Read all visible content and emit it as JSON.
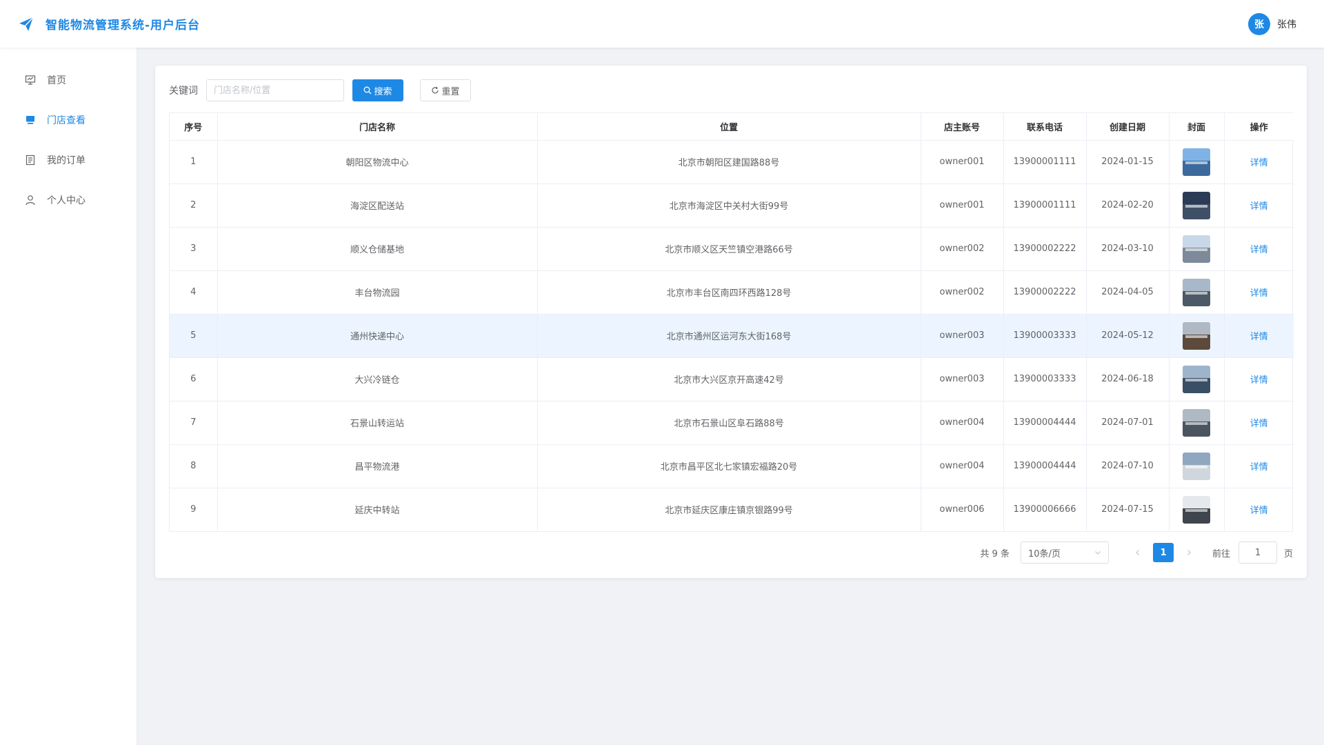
{
  "header": {
    "title": "智能物流管理系统-用户后台",
    "avatar_text": "张",
    "username": "张伟"
  },
  "sidebar": {
    "items": [
      {
        "label": "首页",
        "icon": "presentation-icon",
        "active": false
      },
      {
        "label": "门店查看",
        "icon": "monitor-icon",
        "active": true
      },
      {
        "label": "我的订单",
        "icon": "document-icon",
        "active": false
      },
      {
        "label": "个人中心",
        "icon": "user-icon",
        "active": false
      }
    ]
  },
  "search": {
    "label": "关键词",
    "placeholder": "门店名称/位置",
    "search_button": "搜索",
    "reset_button": "重置"
  },
  "table": {
    "columns": [
      "序号",
      "门店名称",
      "位置",
      "店主账号",
      "联系电话",
      "创建日期",
      "封面",
      "操作"
    ],
    "rows": [
      {
        "index": "1",
        "name": "朝阳区物流中心",
        "location": "北京市朝阳区建国路88号",
        "owner": "owner001",
        "phone": "13900001111",
        "date": "2024-01-15",
        "action": "详情"
      },
      {
        "index": "2",
        "name": "海淀区配送站",
        "location": "北京市海淀区中关村大街99号",
        "owner": "owner001",
        "phone": "13900001111",
        "date": "2024-02-20",
        "action": "详情"
      },
      {
        "index": "3",
        "name": "顺义仓储基地",
        "location": "北京市顺义区天竺镇空港路66号",
        "owner": "owner002",
        "phone": "13900002222",
        "date": "2024-03-10",
        "action": "详情"
      },
      {
        "index": "4",
        "name": "丰台物流园",
        "location": "北京市丰台区南四环西路128号",
        "owner": "owner002",
        "phone": "13900002222",
        "date": "2024-04-05",
        "action": "详情"
      },
      {
        "index": "5",
        "name": "通州快递中心",
        "location": "北京市通州区运河东大街168号",
        "owner": "owner003",
        "phone": "13900003333",
        "date": "2024-05-12",
        "action": "详情"
      },
      {
        "index": "6",
        "name": "大兴冷链仓",
        "location": "北京市大兴区京开高速42号",
        "owner": "owner003",
        "phone": "13900003333",
        "date": "2024-06-18",
        "action": "详情"
      },
      {
        "index": "7",
        "name": "石景山转运站",
        "location": "北京市石景山区阜石路88号",
        "owner": "owner004",
        "phone": "13900004444",
        "date": "2024-07-01",
        "action": "详情"
      },
      {
        "index": "8",
        "name": "昌平物流港",
        "location": "北京市昌平区北七家镇宏福路20号",
        "owner": "owner004",
        "phone": "13900004444",
        "date": "2024-07-10",
        "action": "详情"
      },
      {
        "index": "9",
        "name": "延庆中转站",
        "location": "北京市延庆区康庄镇京银路99号",
        "owner": "owner006",
        "phone": "13900006666",
        "date": "2024-07-15",
        "action": "详情"
      }
    ]
  },
  "pagination": {
    "total": "共 9 条",
    "page_size": "10条/页",
    "current_page": "1",
    "goto_label": "前往",
    "goto_value": "1",
    "page_label": "页"
  },
  "colors": {
    "accent": "#1e88e5",
    "hover_row": "#ecf5ff"
  }
}
